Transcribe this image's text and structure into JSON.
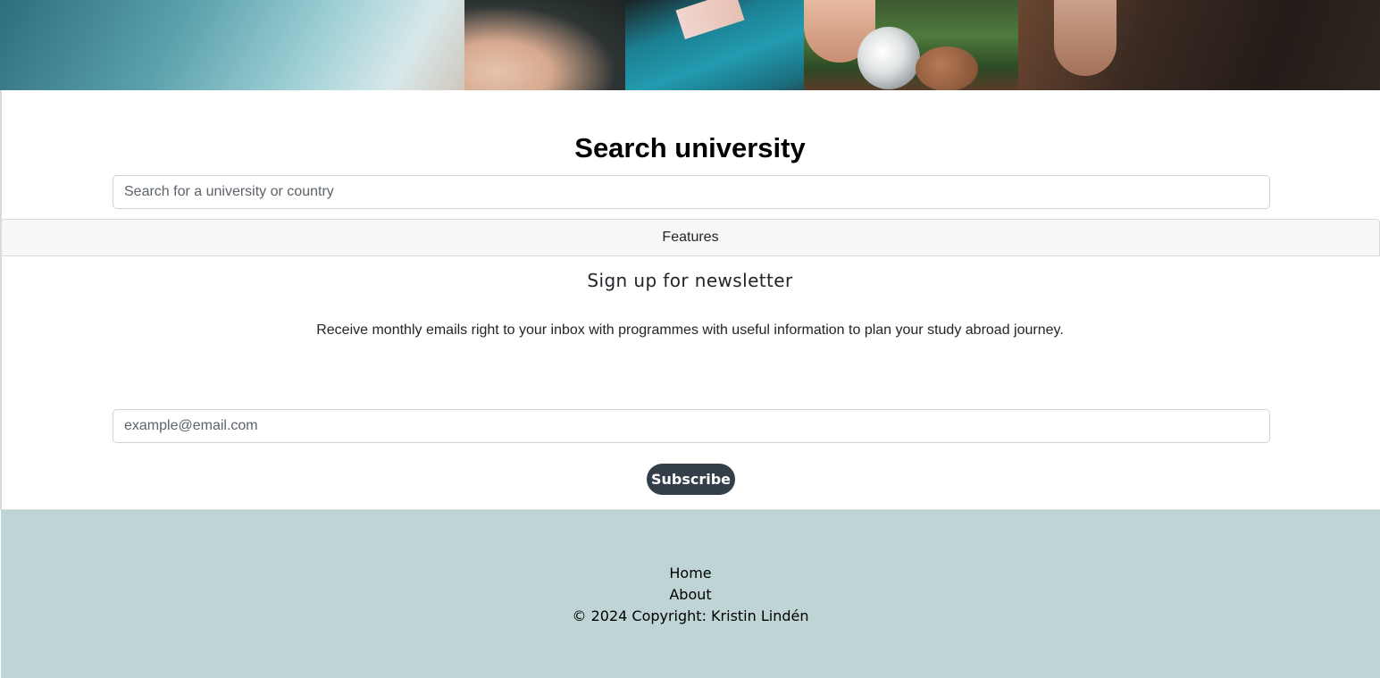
{
  "search": {
    "heading": "Search university",
    "placeholder": "Search for a university or country"
  },
  "features": {
    "label": "Features"
  },
  "newsletter": {
    "heading": "Sign up for newsletter",
    "description": "Receive monthly emails right to your inbox with programmes with useful information to plan your study abroad journey.",
    "email_placeholder": "example@email.com",
    "subscribe_label": "Subscribe"
  },
  "footer": {
    "links": [
      {
        "label": "Home"
      },
      {
        "label": "About"
      }
    ],
    "copyright": "© 2024 Copyright: Kristin Lindén"
  },
  "colors": {
    "button_bg": "#343f49",
    "footer_bg": "#bfd4d5",
    "features_bg": "#f7f7f7"
  }
}
